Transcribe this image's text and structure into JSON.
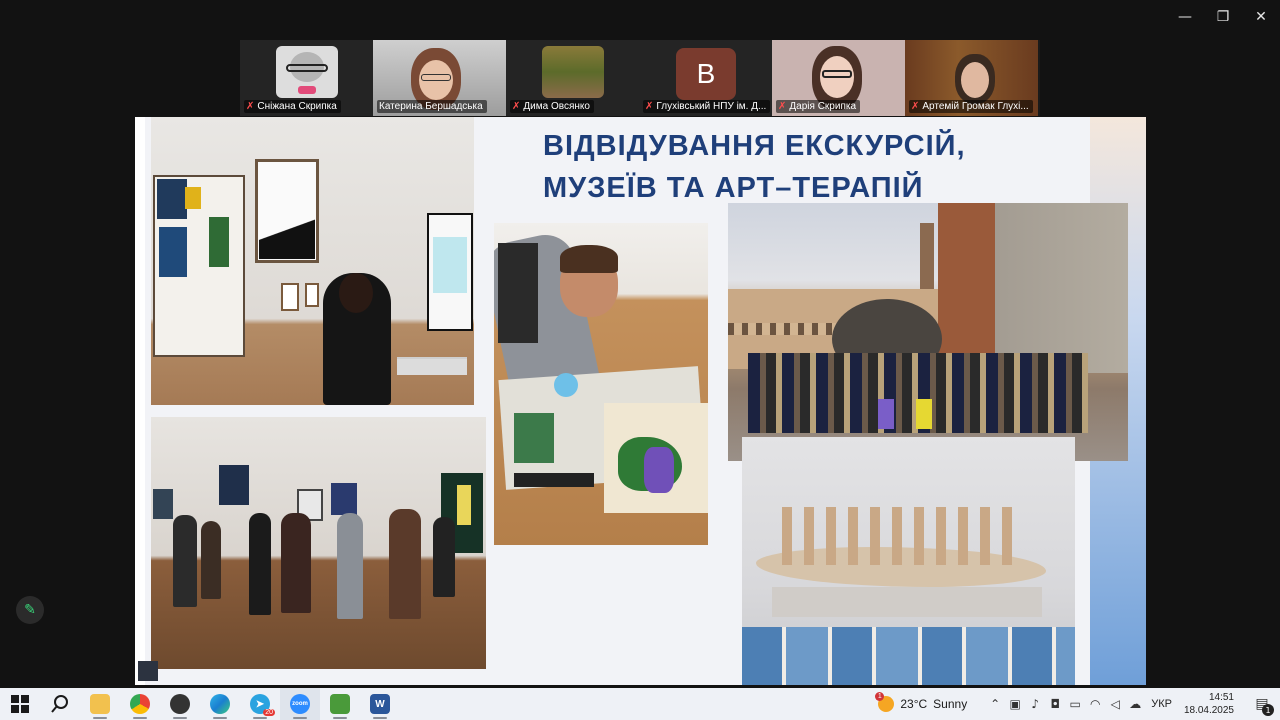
{
  "window": {
    "minimize_icon": "minimize-icon",
    "restore_icon": "restore-icon",
    "close_icon": "close-icon"
  },
  "participants": [
    {
      "name": "Сніжана Скрипка",
      "muted": true
    },
    {
      "name": "Катерина Бершадська",
      "muted": false,
      "active": true
    },
    {
      "name": "Дима Овсянко",
      "muted": true
    },
    {
      "name": "Глухівський НПУ ім. Д...",
      "muted": true,
      "avatar_letter": "B"
    },
    {
      "name": "Дарія Скрипка",
      "muted": true
    },
    {
      "name": "Артемій Громак Глухі...",
      "muted": true
    }
  ],
  "slide": {
    "title_line1": "ВІДВІДУВАННЯ ЕКСКУРСІЙ,",
    "title_line2": "МУЗЕЇВ ТА АРТ–ТЕРАПІЙ",
    "title_color": "#1f3f7a"
  },
  "taskbar": {
    "apps": [
      "windows-start-icon",
      "search-icon",
      "file-explorer-icon",
      "chrome-icon",
      "app-icon",
      "edge-icon",
      "telegram-icon",
      "zoom-icon",
      "app2-icon",
      "word-icon"
    ],
    "telegram_badge": "20",
    "zoom_label": "zoom",
    "word_label": "W",
    "weather_temp": "23°C",
    "weather_desc": "Sunny",
    "weather_badge": "1",
    "language": "УКР",
    "time": "14:51",
    "date": "18.04.2025",
    "notifications_count": "1"
  }
}
